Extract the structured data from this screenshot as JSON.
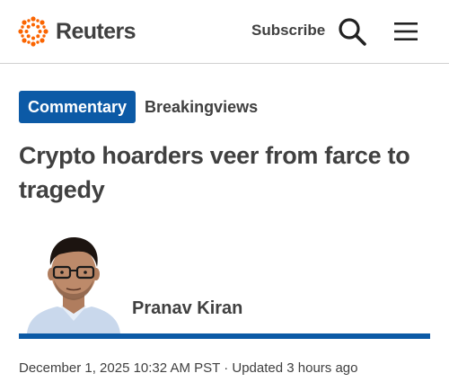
{
  "header": {
    "brand": "Reuters",
    "subscribe_label": "Subscribe",
    "icons": {
      "logo": "reuters-logo-dots",
      "search": "search-icon",
      "menu": "hamburger-menu-icon"
    },
    "brand_accent_color": "#fa6400"
  },
  "tags": {
    "primary": "Commentary",
    "secondary": "Breakingviews",
    "primary_color": "#0c5aa6"
  },
  "article": {
    "headline": "Crypto hoarders veer from farce to tragedy",
    "author": {
      "name": "Pranav Kiran",
      "photo_alt": "Pranav Kiran",
      "accent_color": "#0c5aa6"
    },
    "dateline": {
      "published": "December 1, 2025 10:32 AM PST",
      "separator": "·",
      "updated": "Updated 3 hours ago"
    }
  }
}
